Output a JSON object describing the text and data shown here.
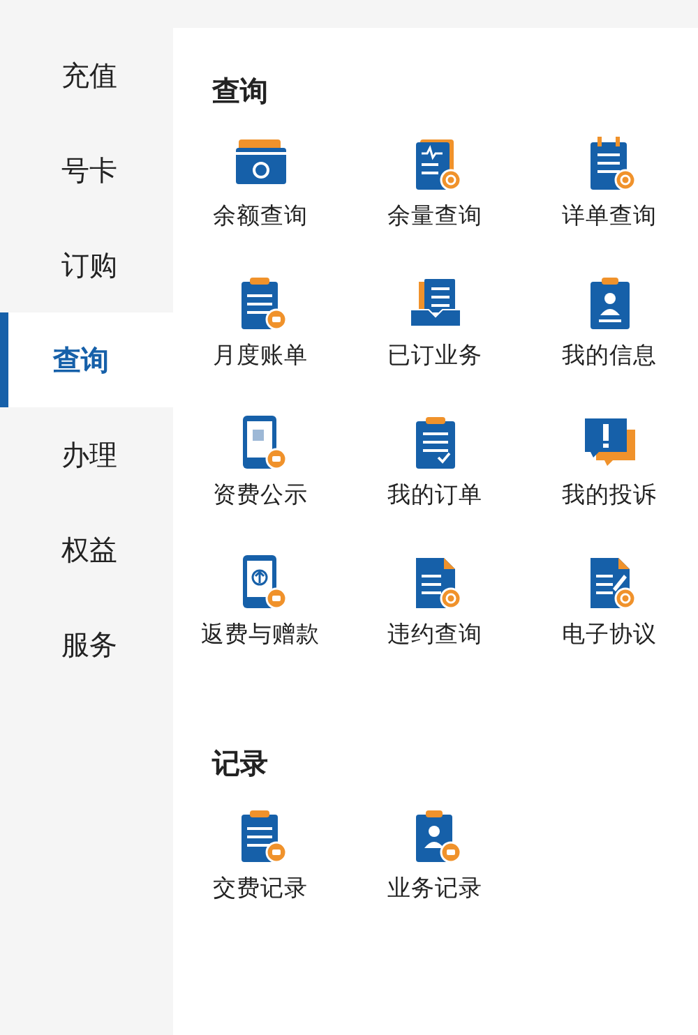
{
  "sidebar": {
    "items": [
      {
        "label": "充值",
        "selected": false
      },
      {
        "label": "号卡",
        "selected": false
      },
      {
        "label": "订购",
        "selected": false
      },
      {
        "label": "查询",
        "selected": true
      },
      {
        "label": "办理",
        "selected": false
      },
      {
        "label": "权益",
        "selected": false
      },
      {
        "label": "服务",
        "selected": false
      }
    ]
  },
  "sections": [
    {
      "title": "查询",
      "items": [
        {
          "label": "余额查询"
        },
        {
          "label": "余量查询"
        },
        {
          "label": "详单查询"
        },
        {
          "label": "月度账单"
        },
        {
          "label": "已订业务"
        },
        {
          "label": "我的信息"
        },
        {
          "label": "资费公示"
        },
        {
          "label": "我的订单"
        },
        {
          "label": "我的投诉"
        },
        {
          "label": "返费与赠款"
        },
        {
          "label": "违约查询"
        },
        {
          "label": "电子协议"
        }
      ]
    },
    {
      "title": "记录",
      "items": [
        {
          "label": "交费记录"
        },
        {
          "label": "业务记录"
        }
      ]
    }
  ]
}
